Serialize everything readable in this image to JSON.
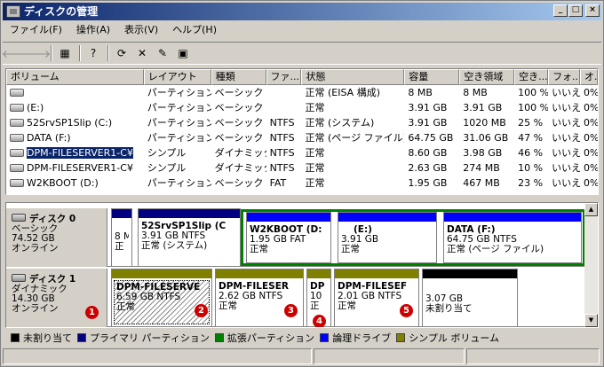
{
  "window": {
    "title": "ディスクの管理",
    "btn_min": "_",
    "btn_max": "□",
    "btn_close": "×"
  },
  "menu": [
    "ファイル(F)",
    "操作(A)",
    "表示(V)",
    "ヘルプ(H)"
  ],
  "toolbar": {
    "icons": [
      "back-arrow-icon",
      "forward-arrow-icon",
      "properties-pane-icon",
      "help-icon",
      "refresh-icon",
      "delete-icon",
      "properties-icon",
      "export-icon"
    ],
    "glyphs": {
      "back": "🡐",
      "forward": "🡒",
      "pane": "▦",
      "help": "?",
      "refresh": "⟳",
      "delete": "✕",
      "props": "✎",
      "export": "▣"
    }
  },
  "columns": [
    "ボリューム",
    "レイアウト",
    "種類",
    "ファ...",
    "状態",
    "容量",
    "空き領域",
    "空き...",
    "フォ...",
    "オ..."
  ],
  "volumes": [
    [
      "",
      "パーティション",
      "ベーシック",
      "",
      "正常 (EISA 構成)",
      "8 MB",
      "8 MB",
      "100 %",
      "いいえ",
      "0%"
    ],
    [
      "(E:)",
      "パーティション",
      "ベーシック",
      "",
      "正常",
      "3.91 GB",
      "3.91 GB",
      "100 %",
      "いいえ",
      "0%"
    ],
    [
      "52SrvSP1Slip (C:)",
      "パーティション",
      "ベーシック",
      "NTFS",
      "正常 (システム)",
      "3.91 GB",
      "1020 MB",
      "25 %",
      "いいえ",
      "0%"
    ],
    [
      "DATA (F:)",
      "パーティション",
      "ベーシック",
      "NTFS",
      "正常 (ページ ファイル)",
      "64.75 GB",
      "31.06 GB",
      "47 %",
      "いいえ",
      "0%"
    ],
    [
      "DPM-FILESERVER1-C¥",
      "シンプル",
      "ダイナミック",
      "NTFS",
      "正常",
      "8.60 GB",
      "3.98 GB",
      "46 %",
      "いいえ",
      "0%"
    ],
    [
      "DPM-FILESERVER1-C¥",
      "シンプル",
      "ダイナミック",
      "NTFS",
      "正常",
      "2.63 GB",
      "274 MB",
      "10 %",
      "いいえ",
      "0%"
    ],
    [
      "W2KBOOT (D:)",
      "パーティション",
      "ベーシック",
      "FAT",
      "正常",
      "1.95 GB",
      "467 MB",
      "23 %",
      "いいえ",
      "0%"
    ]
  ],
  "disk0": {
    "name": "ディスク 0",
    "type": "ベーシック",
    "size": "74.52 GB",
    "status": "オンライン",
    "parts": [
      {
        "l1": "8 M",
        "l2": "正"
      },
      {
        "name": "52SrvSP1Slip (C",
        "l1": "3.91 GB NTFS",
        "l2": "正常 (システム)"
      },
      {
        "name": "W2KBOOT (D:",
        "l1": "1.95 GB FAT",
        "l2": "正常"
      },
      {
        "name": "(E:)",
        "l1": "3.91 GB",
        "l2": "正常"
      },
      {
        "name": "DATA (F:)",
        "l1": "64.75 GB NTFS",
        "l2": "正常 (ページ ファイル)"
      }
    ]
  },
  "disk1": {
    "name": "ディスク 1",
    "type": "ダイナミック",
    "size": "14.30 GB",
    "status": "オンライン",
    "parts": [
      {
        "name": "DPM-FILESERVE",
        "l1": "6.59 GB NTFS",
        "l2": "正常"
      },
      {
        "name": "DPM-FILESER",
        "l1": "2.62 GB NTFS",
        "l2": "正常"
      },
      {
        "name": "DP",
        "l1": "10",
        "l2": "正"
      },
      {
        "name": "DPM-FILESEF",
        "l1": "2.01 GB NTFS",
        "l2": "正常"
      },
      {
        "l1": "3.07 GB",
        "l2": "未割り当て"
      }
    ]
  },
  "badges": [
    "1",
    "2",
    "3",
    "4",
    "5"
  ],
  "legend": [
    {
      "label": "未割り当て",
      "color": "#000000"
    },
    {
      "label": "プライマリ パーティション",
      "color": "#000080"
    },
    {
      "label": "拡張パーティション",
      "color": "#008000"
    },
    {
      "label": "論理ドライブ",
      "color": "#0000ff"
    },
    {
      "label": "シンプル ボリューム",
      "color": "#808000"
    }
  ]
}
